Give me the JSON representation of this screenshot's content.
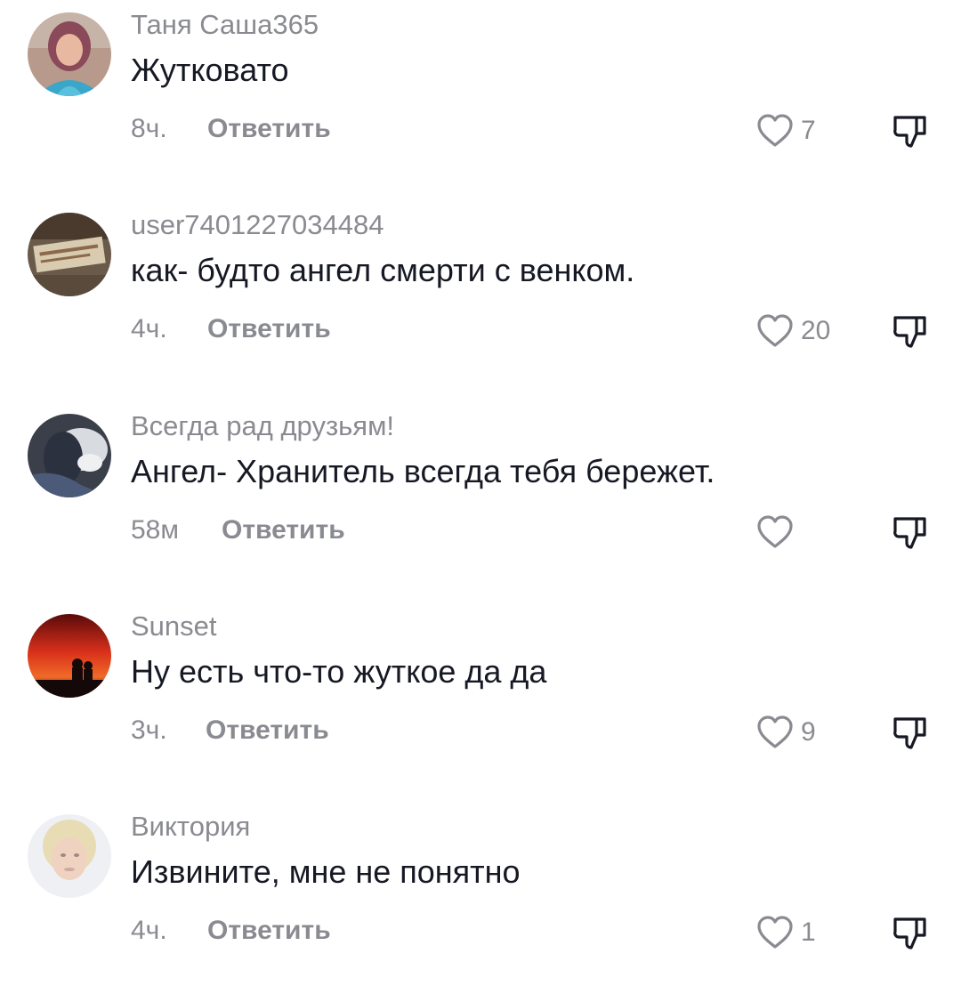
{
  "comments": [
    {
      "username": "Таня Саша365",
      "text": "Жутковато",
      "time": "8ч.",
      "reply_label": "Ответить",
      "likes": "7",
      "avatar": "woman-portrait-avatar"
    },
    {
      "username": "user7401227034484",
      "text": "как- будто ангел смерти с венком.",
      "time": "4ч.",
      "reply_label": "Ответить",
      "likes": "20",
      "avatar": "jeans-label-avatar"
    },
    {
      "username": "Всегда рад друзьям!",
      "text": "Ангел- Хранитель всегда тебя бережет.",
      "time": "58м",
      "reply_label": "Ответить",
      "likes": "",
      "avatar": "dog-photo-avatar"
    },
    {
      "username": "Sunset",
      "text": "Ну есть что-то жуткое да да",
      "time": "3ч.",
      "reply_label": "Ответить",
      "likes": "9",
      "avatar": "sunset-silhouette-avatar"
    },
    {
      "username": "Виктория",
      "text": "Извините, мне не понятно",
      "time": "4ч.",
      "reply_label": "Ответить",
      "likes": "1",
      "avatar": "blonde-woman-avatar"
    }
  ],
  "colors": {
    "primary_text": "#161823",
    "secondary_text": "#8a8b91",
    "background": "#ffffff"
  },
  "icons": {
    "like": "heart-outline-icon",
    "dislike": "thumbs-down-icon"
  }
}
